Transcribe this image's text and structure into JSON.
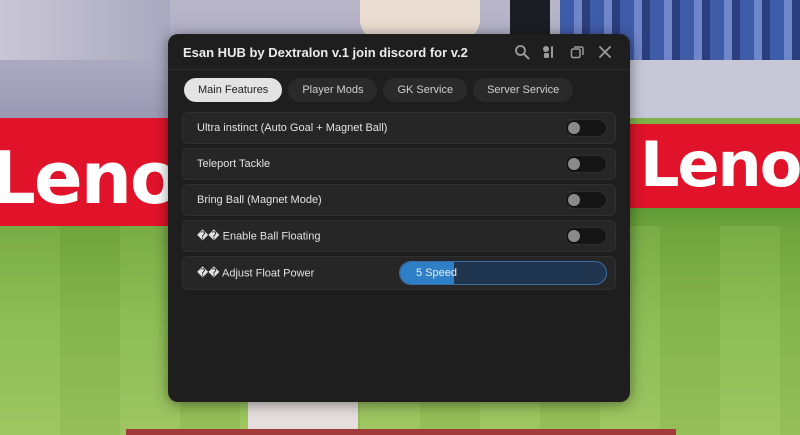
{
  "background": {
    "board_text": "Lenovo",
    "board_text_right": "Lenovo"
  },
  "window": {
    "title": "Esan HUB by Dextralon v.1 join discord for v.2",
    "icons": [
      "search-icon",
      "stats-icon",
      "restore-icon",
      "close-icon"
    ]
  },
  "tabs": [
    {
      "label": "Main Features",
      "active": true
    },
    {
      "label": "Player Mods",
      "active": false
    },
    {
      "label": "GK Service",
      "active": false
    },
    {
      "label": "Server Service",
      "active": false
    }
  ],
  "toggles": [
    {
      "label": "Ultra instinct (Auto Goal + Magnet Ball)",
      "on": false
    },
    {
      "label": "Teleport Tackle",
      "on": false
    },
    {
      "label": "Bring Ball (Magnet Mode)",
      "on": false
    },
    {
      "label": "�� Enable Ball Floating",
      "on": false
    }
  ],
  "slider": {
    "label": "�� Adjust Float Power",
    "value_text": "5 Speed",
    "fill_fraction": 0.26
  },
  "colors": {
    "window_bg": "#1e1e1e",
    "accent": "#2f7fc7",
    "board_red": "#e0132a"
  }
}
